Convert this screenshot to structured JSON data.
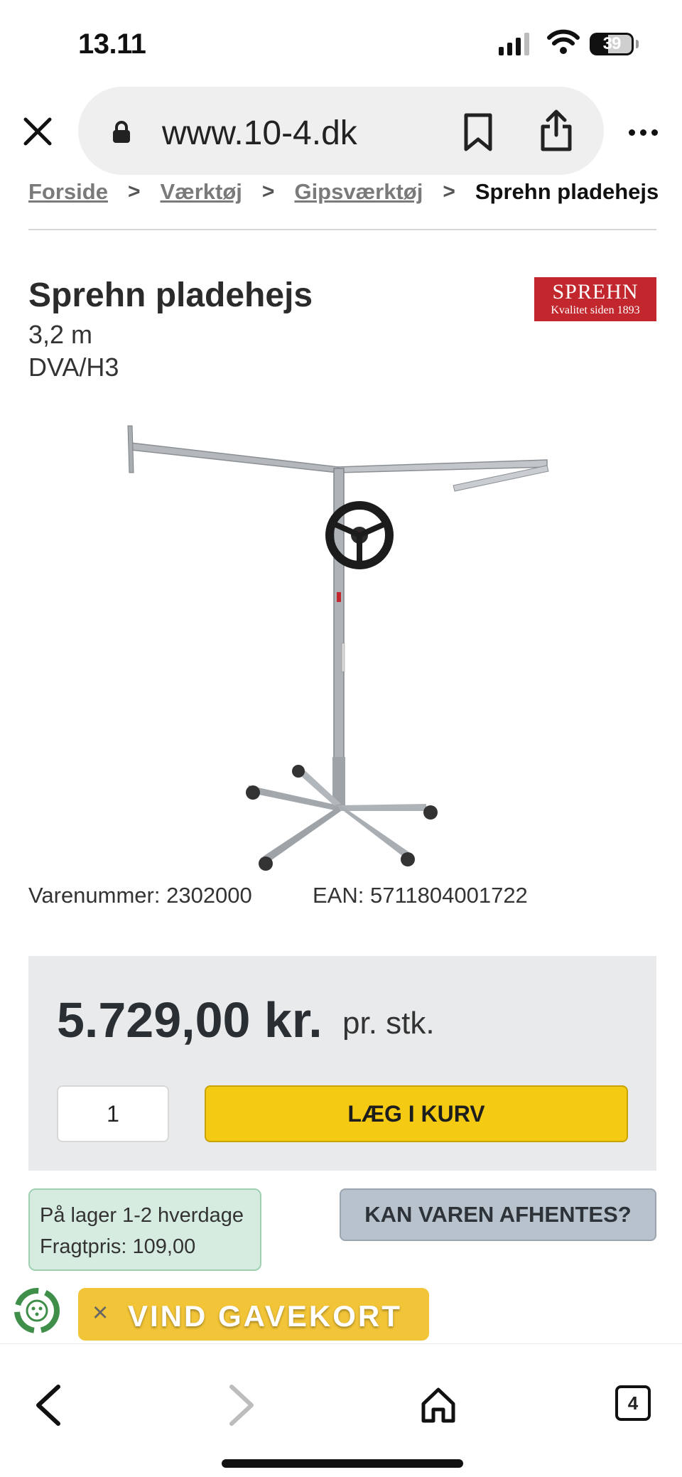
{
  "status_bar": {
    "time": "13.11",
    "battery": "39"
  },
  "browser": {
    "url": "www.10-4.dk",
    "tab_count": "4"
  },
  "breadcrumb": {
    "items": [
      "Forside",
      "Værktøj",
      "Gipsværktøj"
    ],
    "current": "Sprehn pladehejs",
    "separator": ">"
  },
  "product": {
    "title": "Sprehn pladehejs",
    "spec_length": "3,2 m",
    "spec_code": "DVA/H3",
    "brand_name": "SPREHN",
    "brand_tagline": "Kvalitet siden 1893",
    "brand_color": "#c1272d",
    "sku": "Varenummer: 2302000",
    "ean": "EAN: 5711804001722"
  },
  "purchase": {
    "price": "5.729,00 kr.",
    "unit": "pr. stk.",
    "quantity": "1",
    "add_to_cart": "LÆG I KURV",
    "cta_color": "#f4cb12"
  },
  "stock": {
    "line1": "På lager 1-2 hverdage",
    "line2": "Fragtpris: 109,00"
  },
  "pickup_button": "KAN VAREN AFHENTES?",
  "gift_banner": {
    "close": "×",
    "text": "VIND GAVEKORT"
  },
  "icons": [
    "close-icon",
    "lock-icon",
    "bookmark-icon",
    "share-icon",
    "more-icon",
    "back-icon",
    "forward-icon",
    "home-icon",
    "tabs-icon",
    "recycle-icon"
  ]
}
